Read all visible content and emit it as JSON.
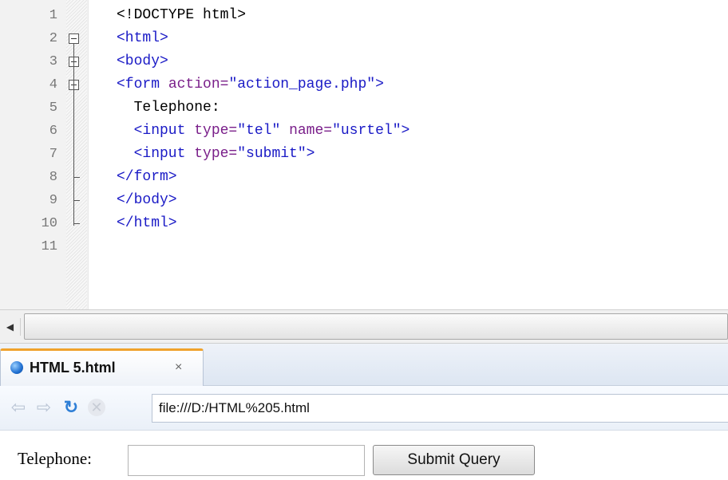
{
  "editor": {
    "lines": [
      {
        "num": "1",
        "tokens": [
          {
            "t": "doc",
            "v": "<!DOCTYPE html>"
          }
        ]
      },
      {
        "num": "2",
        "tokens": [
          {
            "t": "tag",
            "v": "<html>"
          }
        ]
      },
      {
        "num": "3",
        "tokens": [
          {
            "t": "tag",
            "v": "<body>"
          }
        ]
      },
      {
        "num": "4",
        "tokens": [
          {
            "t": "tag",
            "v": "<form "
          },
          {
            "t": "attr",
            "v": "action="
          },
          {
            "t": "str",
            "v": "\"action_page.php\""
          },
          {
            "t": "tag",
            "v": ">"
          }
        ]
      },
      {
        "num": "5",
        "tokens": [
          {
            "t": "text",
            "v": "  Telephone:"
          }
        ]
      },
      {
        "num": "6",
        "tokens": [
          {
            "t": "tag",
            "v": "  <input "
          },
          {
            "t": "attr",
            "v": "type="
          },
          {
            "t": "str",
            "v": "\"tel\""
          },
          {
            "t": "tag",
            "v": " "
          },
          {
            "t": "attr",
            "v": "name="
          },
          {
            "t": "str",
            "v": "\"usrtel\""
          },
          {
            "t": "tag",
            "v": ">"
          }
        ]
      },
      {
        "num": "7",
        "tokens": [
          {
            "t": "tag",
            "v": "  <input "
          },
          {
            "t": "attr",
            "v": "type="
          },
          {
            "t": "str",
            "v": "\"submit\""
          },
          {
            "t": "tag",
            "v": ">"
          }
        ]
      },
      {
        "num": "8",
        "tokens": [
          {
            "t": "tag",
            "v": "</form>"
          }
        ]
      },
      {
        "num": "9",
        "tokens": [
          {
            "t": "tag",
            "v": "</body>"
          }
        ]
      },
      {
        "num": "10",
        "tokens": [
          {
            "t": "tag",
            "v": "</html>"
          }
        ]
      },
      {
        "num": "11",
        "tokens": []
      }
    ]
  },
  "browser": {
    "tab_title": "HTML 5.html",
    "tab_close": "×",
    "address": "file:///D:/HTML%205.html",
    "icons": {
      "back": "back-arrow-icon",
      "forward": "forward-arrow-icon",
      "reload": "reload-icon",
      "stop": "stop-icon",
      "tab": "globe-icon"
    }
  },
  "page": {
    "label": "Telephone:",
    "input_value": "",
    "submit_label": "Submit Query"
  },
  "colors": {
    "tag": "#1a1ac6",
    "attr": "#7a1f8a",
    "tab_accent": "#f0a22c"
  }
}
